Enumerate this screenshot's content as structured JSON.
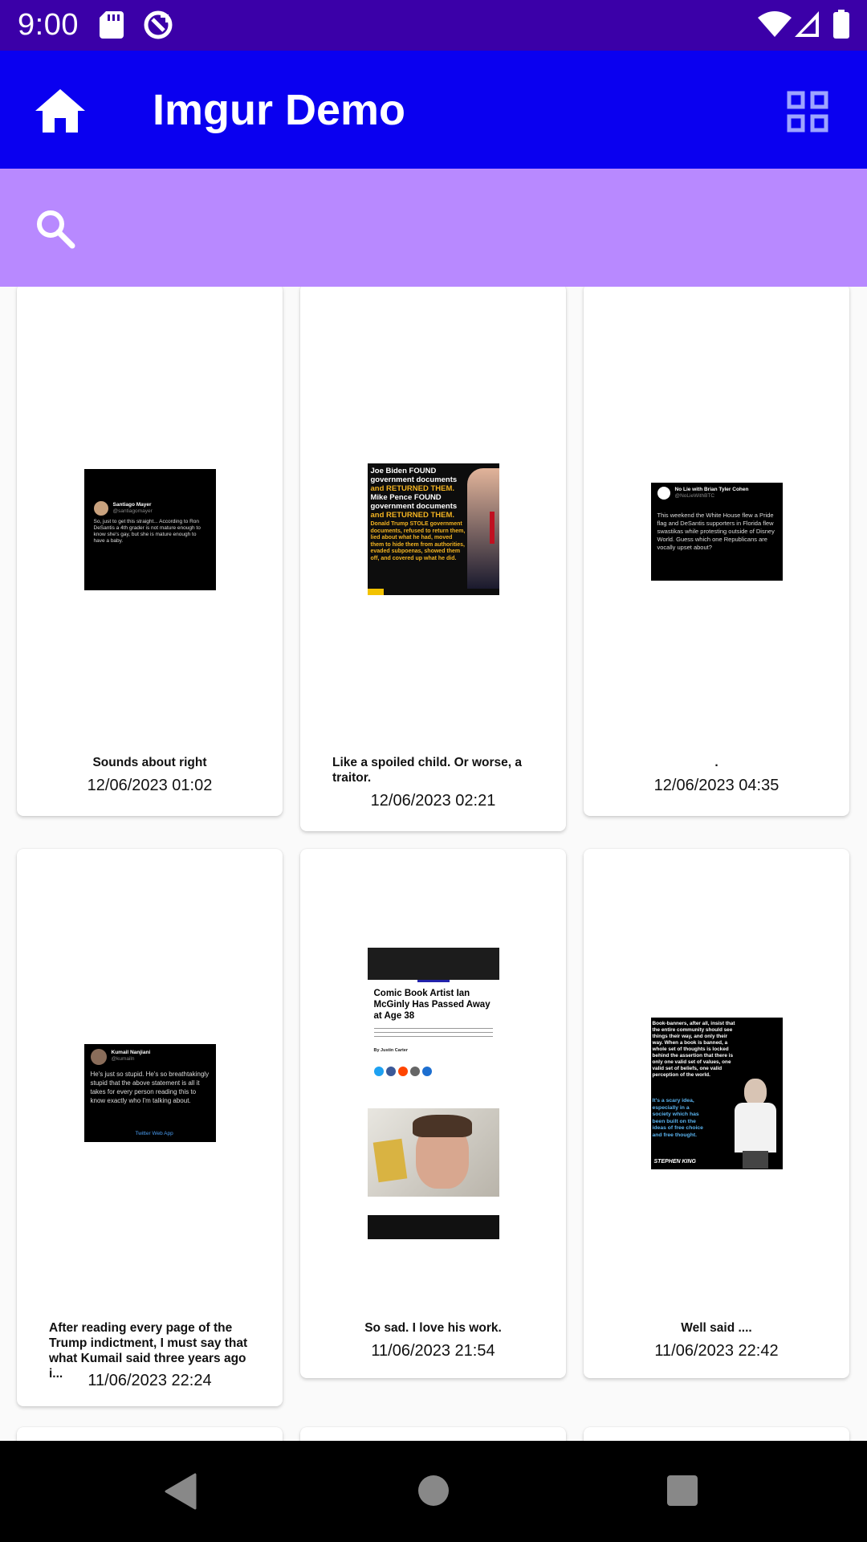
{
  "status_bar": {
    "time": "9:00",
    "icons": [
      "sd-card-icon",
      "sync-icon",
      "wifi-icon",
      "signal-icon",
      "battery-icon"
    ]
  },
  "app_bar": {
    "title": "Imgur Demo",
    "left_icon": "home-icon",
    "right_icon": "grid-view-icon",
    "background": "#0a00f0"
  },
  "search": {
    "icon": "search-icon",
    "value": "",
    "background": "#b889ff"
  },
  "posts": [
    {
      "caption": "Sounds about right",
      "date": "12/06/2023 01:02",
      "thumb": {
        "author": "Santiago Mayer",
        "handle": "@santiagomayer",
        "text": "So, just to get this straight... According to Ron DeSantis a 4th grader is not mature enough to know she's gay, but she is mature enough to have a baby."
      }
    },
    {
      "caption": "Like a spoiled child. Or worse, a traitor.",
      "date": "12/06/2023 02:21",
      "thumb": {
        "lines": [
          "Joe Biden FOUND",
          "government documents",
          "and RETURNED THEM.",
          "Mike Pence FOUND",
          "government documents",
          "and RETURNED THEM.",
          "Donald Trump STOLE government",
          "documents, refused to return them,",
          "lied about what he had, moved",
          "them to hide them from authorities,",
          "evaded subpoenas, showed them",
          "off, and covered up what he did."
        ]
      }
    },
    {
      "caption": ".",
      "date": "12/06/2023 04:35",
      "thumb": {
        "author": "No Lie with Brian Tyler Cohen",
        "handle": "@NoLieWithBTC",
        "text": "This weekend the White House flew a Pride flag and DeSantis supporters in Florida flew swastikas while protesting outside of Disney World. Guess which one Republicans are vocally upset about?"
      }
    },
    {
      "caption": "After reading every page of the Trump indictment, I must say that what Kumail said three years ago i...",
      "date": "11/06/2023 22:24",
      "thumb": {
        "author": "Kumail Nanjiani",
        "handle": "@kumailn",
        "text": "He's just so stupid. He's so breathtakingly stupid that the above statement is all it takes for every person reading this to know exactly who I'm talking about.",
        "footer": "Twitter Web App"
      }
    },
    {
      "caption": "So sad. I love his work.",
      "date": "11/06/2023 21:54",
      "thumb": {
        "headline": "Comic Book Artist Ian McGinly Has Passed Away at Age 38",
        "byline": "By Justin Carter"
      }
    },
    {
      "caption": "Well said ....",
      "date": "11/06/2023 22:42",
      "thumb": {
        "quote": "Book-banners, after all, insist that the entire community should see things their way, and only their way. When a book is banned, a whole set of thoughts is locked behind the assertion that there is only one valid set of values, one valid set of beliefs, one valid perception of the world.",
        "quote_highlight": "It's a scary idea, especially in a society which has been built on the ideas of free choice and free thought.",
        "attribution": "STEPHEN KING"
      }
    }
  ],
  "nav_bar": {
    "buttons": [
      "back-icon",
      "home-circle-icon",
      "recents-icon"
    ]
  }
}
